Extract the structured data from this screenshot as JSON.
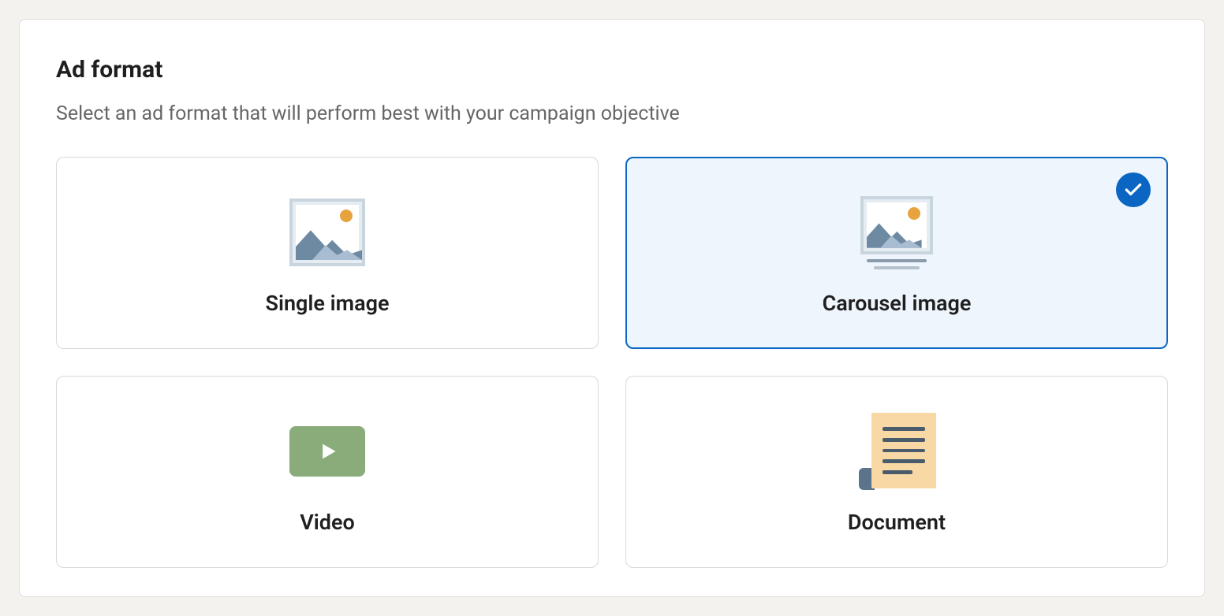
{
  "section": {
    "title": "Ad format",
    "subtitle": "Select an ad format that will perform best with your campaign objective"
  },
  "options": {
    "single_image": {
      "label": "Single image",
      "selected": false
    },
    "carousel_image": {
      "label": "Carousel image",
      "selected": true
    },
    "video": {
      "label": "Video",
      "selected": false
    },
    "document": {
      "label": "Document",
      "selected": false
    }
  }
}
